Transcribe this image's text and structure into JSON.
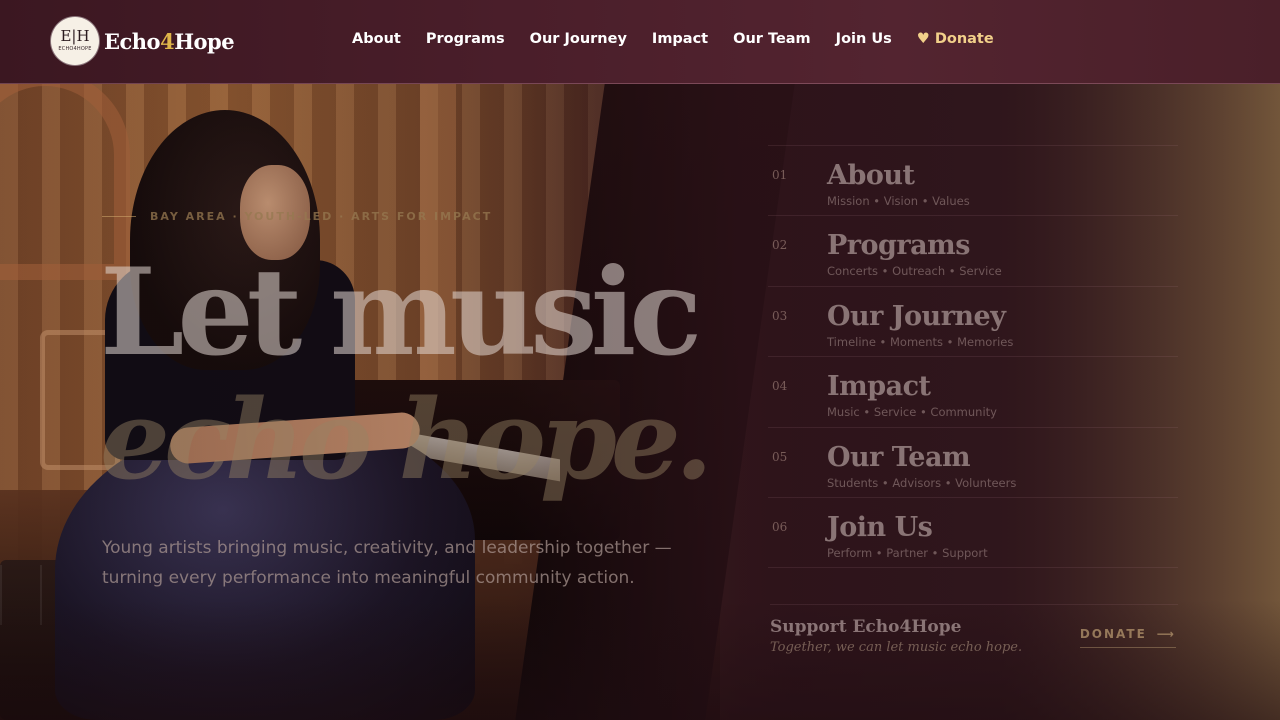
{
  "brand": {
    "logo_mark": "E|H",
    "logo_small": "ECHO4HOPE",
    "name_part1": "Echo",
    "name_accent": "4",
    "name_part2": "Hope"
  },
  "nav": {
    "items": [
      "About",
      "Programs",
      "Our Journey",
      "Impact",
      "Our Team",
      "Join Us"
    ],
    "donate": "♥ Donate"
  },
  "hero": {
    "eyebrow": "BAY AREA · YOUTH-LED · ARTS FOR IMPACT",
    "headline_line1": "Let music",
    "headline_line2": "echo hope.",
    "subcopy": "Young artists bringing music, creativity, and leadership together — turning every performance into meaningful community action."
  },
  "menu": {
    "items": [
      {
        "num": "01",
        "title": "About",
        "sub": "Mission • Vision • Values"
      },
      {
        "num": "02",
        "title": "Programs",
        "sub": "Concerts • Outreach • Service"
      },
      {
        "num": "03",
        "title": "Our Journey",
        "sub": "Timeline • Moments • Memories"
      },
      {
        "num": "04",
        "title": "Impact",
        "sub": "Music • Service • Community"
      },
      {
        "num": "05",
        "title": "Our Team",
        "sub": "Students • Advisors • Volunteers"
      },
      {
        "num": "06",
        "title": "Join Us",
        "sub": "Perform • Partner • Support"
      }
    ]
  },
  "support": {
    "title": "Support Echo4Hope",
    "tagline": "Together, we can let music echo hope.",
    "cta": "DONATE",
    "cta_icon": "arrow-right-icon"
  },
  "colors": {
    "nav_bg": "#4a1e2a",
    "brand_accent": "#e0b64a",
    "donate_link": "#f2d08a"
  }
}
